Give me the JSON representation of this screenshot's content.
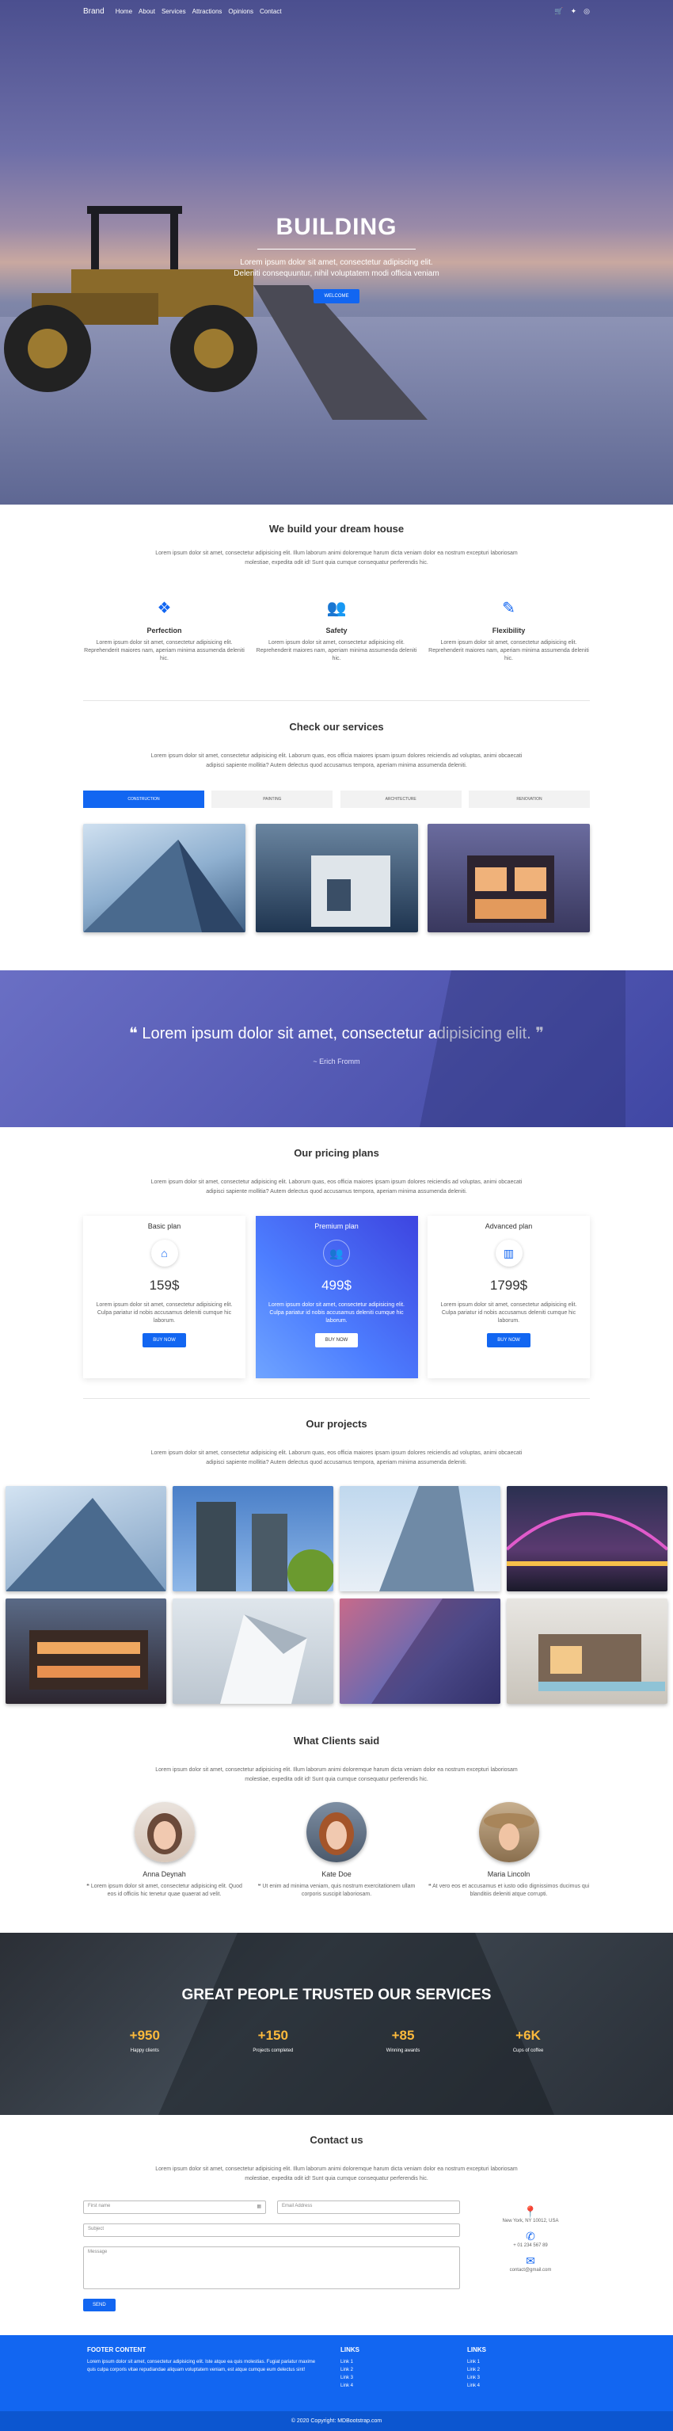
{
  "nav": {
    "brand": "Brand",
    "links": [
      "Home",
      "About",
      "Services",
      "Attractions",
      "Opinions",
      "Contact"
    ]
  },
  "hero": {
    "title": "BUILDING",
    "text": "Lorem ipsum dolor sit amet, consectetur adipiscing elit. Deleniti consequuntur, nihil voluptatem modi officia veniam",
    "button": "Welcome"
  },
  "dream": {
    "title": "We build your dream house",
    "desc": "Lorem ipsum dolor sit amet, consectetur adipisicing elit. Illum laborum animi doloremque harum dicta veniam dolor ea nostrum excepturi laboriosam molestiae, expedita odit id! Sunt quia cumque consequatur perferendis hic.",
    "features": [
      {
        "icon": "cubes-icon",
        "title": "Perfection",
        "text": "Lorem ipsum dolor sit amet, consectetur adipisicing elit. Reprehenderit maiores nam, aperiam minima assumenda deleniti hic."
      },
      {
        "icon": "users-icon",
        "title": "Safety",
        "text": "Lorem ipsum dolor sit amet, consectetur adipisicing elit. Reprehenderit maiores nam, aperiam minima assumenda deleniti hic."
      },
      {
        "icon": "magic-icon",
        "title": "Flexibility",
        "text": "Lorem ipsum dolor sit amet, consectetur adipisicing elit. Reprehenderit maiores nam, aperiam minima assumenda deleniti hic."
      }
    ]
  },
  "services": {
    "title": "Check our services",
    "desc": "Lorem ipsum dolor sit amet, consectetur adipisicing elit. Laborum quas, eos officia maiores ipsam ipsum dolores reiciendis ad voluptas, animi obcaecati adipisci sapiente mollitia? Autem delectus quod accusamus tempora, aperiam minima assumenda deleniti.",
    "tabs": [
      "Construction",
      "Painting",
      "Architecture",
      "Renovation"
    ]
  },
  "quote": {
    "text": "Lorem ipsum dolor sit amet, consectetur adipisicing elit.",
    "author": "~ Erich Fromm"
  },
  "pricing": {
    "title": "Our pricing plans",
    "desc": "Lorem ipsum dolor sit amet, consectetur adipisicing elit. Laborum quas, eos officia maiores ipsam ipsum dolores reiciendis ad voluptas, animi obcaecati adipisci sapiente mollitia? Autem delectus quod accusamus tempora, aperiam minima assumenda deleniti.",
    "plans": [
      {
        "name": "Basic plan",
        "icon": "home-icon",
        "price": "159$",
        "text": "Lorem ipsum dolor sit amet, consectetur adipisicing elit. Culpa pariatur id nobis accusamus deleniti cumque hic laborum.",
        "button": "Buy now"
      },
      {
        "name": "Premium plan",
        "icon": "users-icon",
        "price": "499$",
        "text": "Lorem ipsum dolor sit amet, consectetur adipisicing elit. Culpa pariatur id nobis accusamus deleniti cumque hic laborum.",
        "button": "Buy now"
      },
      {
        "name": "Advanced plan",
        "icon": "chart-icon",
        "price": "1799$",
        "text": "Lorem ipsum dolor sit amet, consectetur adipisicing elit. Culpa pariatur id nobis accusamus deleniti cumque hic laborum.",
        "button": "Buy now"
      }
    ]
  },
  "projects": {
    "title": "Our projects",
    "desc": "Lorem ipsum dolor sit amet, consectetur adipisicing elit. Laborum quas, eos officia maiores ipsam ipsum dolores reiciendis ad voluptas, animi obcaecati adipisci sapiente mollitia? Autem delectus quod accusamus tempora, aperiam minima assumenda deleniti."
  },
  "clients": {
    "title": "What Clients said",
    "desc": "Lorem ipsum dolor sit amet, consectetur adipisicing elit. Illum laborum animi doloremque harum dicta veniam dolor ea nostrum excepturi laboriosam molestiae, expedita odit id! Sunt quia cumque consequatur perferendis hic.",
    "items": [
      {
        "name": "Anna Deynah",
        "text": "Lorem ipsum dolor sit amet, consectetur adipisicing elit. Quod eos id officiis hic tenetur quae quaerat ad velit."
      },
      {
        "name": "Kate Doe",
        "text": "Ut enim ad minima veniam, quis nostrum exercitationem ullam corporis suscipit laboriosam."
      },
      {
        "name": "Maria Lincoln",
        "text": "At vero eos et accusamus et iusto odio dignissimos ducimus qui blanditiis deleniti atque corrupti."
      }
    ]
  },
  "stats": {
    "title": "GREAT PEOPLE TRUSTED OUR SERVICES",
    "items": [
      {
        "n": "+950",
        "l": "Happy clients"
      },
      {
        "n": "+150",
        "l": "Projects completed"
      },
      {
        "n": "+85",
        "l": "Winning awards"
      },
      {
        "n": "+6K",
        "l": "Cups of coffee"
      }
    ]
  },
  "contact": {
    "title": "Contact us",
    "desc": "Lorem ipsum dolor sit amet, consectetur adipisicing elit. Illum laborum animi doloremque harum dicta veniam dolor ea nostrum excepturi laboriosam molestiae, expedita odit id! Sunt quia cumque consequatur perferendis hic.",
    "first_name": "First name",
    "email": "Email Address",
    "subject": "Subject",
    "message": "Message",
    "button": "Send",
    "address": "New York, NY 10012, USA",
    "phone": "+ 01 234 567 89",
    "mail": "contact@gmail.com"
  },
  "footer": {
    "title": "FOOTER CONTENT",
    "text": "Lorem ipsum dolor sit amet, consectetur adipisicing elit. Iste atque ea quis molestias. Fugiat pariatur maxime quis culpa corporis vitae repudiandae aliquam voluptatem veniam, est atque cumque eum delectus sint!",
    "links1_title": "LINKS",
    "links1": [
      "Link 1",
      "Link 2",
      "Link 3",
      "Link 4"
    ],
    "links2_title": "LINKS",
    "links2": [
      "Link 1",
      "Link 2",
      "Link 3",
      "Link 4"
    ],
    "copyright": "© 2020 Copyright: MDBootstrap.com"
  },
  "colors": {
    "primary": "#1266f1",
    "accent": "#fbb93c"
  }
}
